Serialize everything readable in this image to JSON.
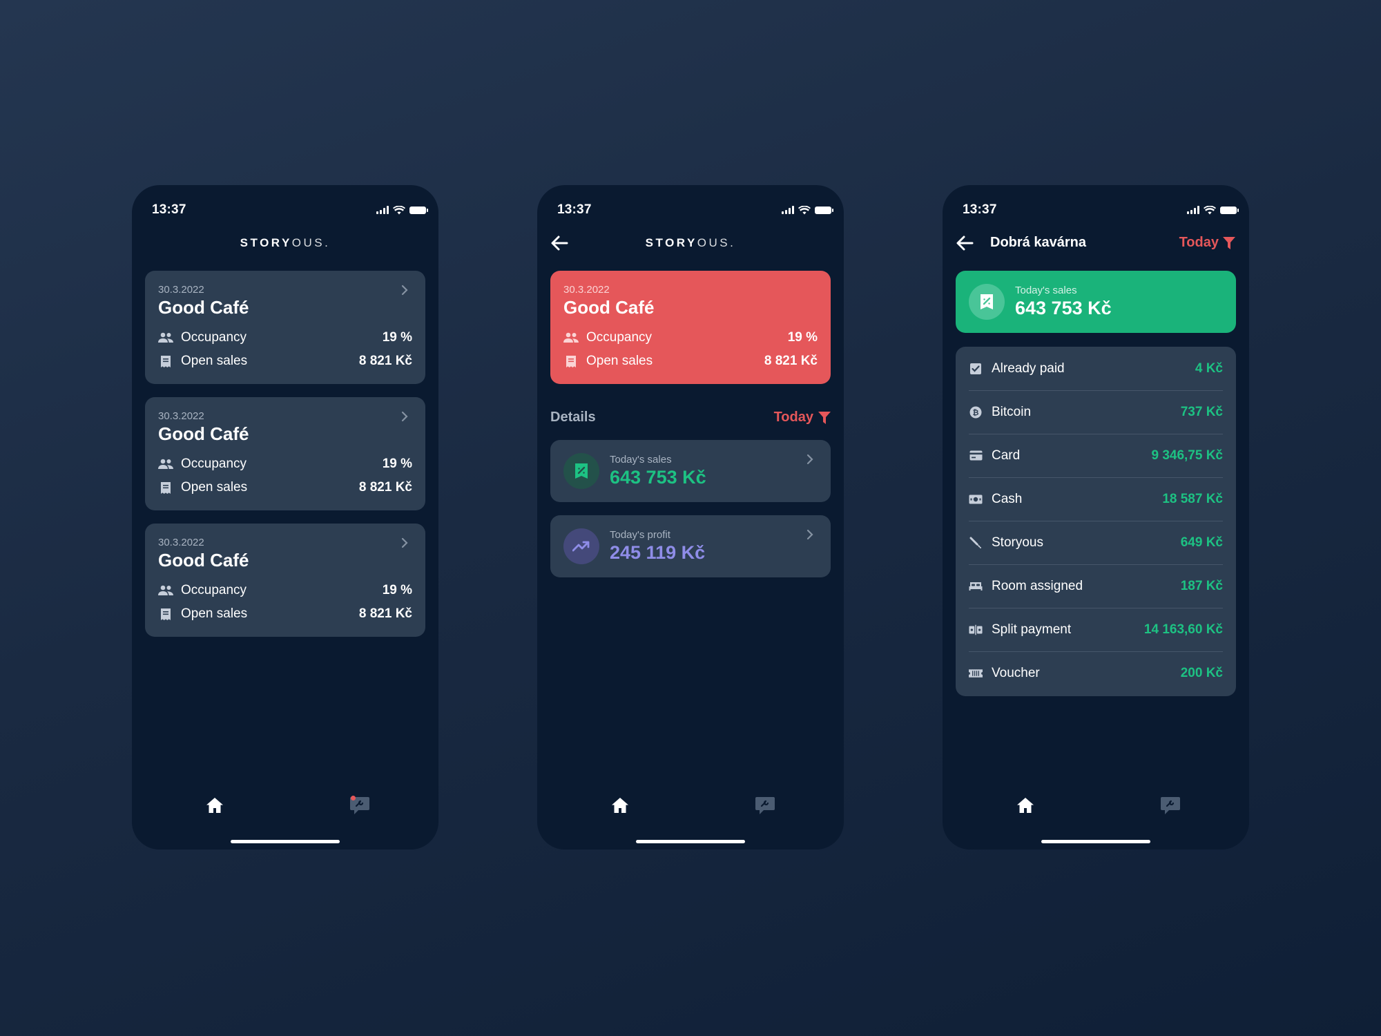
{
  "status": {
    "time": "13:37"
  },
  "brand": {
    "logo_bold": "STORY",
    "logo_light": "OUS."
  },
  "venue": {
    "date": "30.3.2022",
    "name": "Good Café",
    "occupancy_label": "Occupancy",
    "occupancy_value": "19 %",
    "open_sales_label": "Open sales",
    "open_sales_value": "8 821 Kč"
  },
  "details": {
    "title": "Details",
    "filter_label": "Today",
    "sales_label": "Today's sales",
    "sales_value": "643 753 Kč",
    "profit_label": "Today's profit",
    "profit_value": "245 119 Kč"
  },
  "payments_screen": {
    "title": "Dobrá kavárna",
    "filter_label": "Today",
    "total_label": "Today's sales",
    "total_value": "643 753 Kč",
    "items": [
      {
        "label": "Already paid",
        "value": "4 Kč",
        "icon": "check-square-icon"
      },
      {
        "label": "Bitcoin",
        "value": "737 Kč",
        "icon": "bitcoin-icon"
      },
      {
        "label": "Card",
        "value": "9 346,75 Kč",
        "icon": "credit-card-icon"
      },
      {
        "label": "Cash",
        "value": "18 587 Kč",
        "icon": "cash-icon"
      },
      {
        "label": "Storyous",
        "value": "649 Kč",
        "icon": "storyous-icon"
      },
      {
        "label": "Room assigned",
        "value": "187 Kč",
        "icon": "bed-icon"
      },
      {
        "label": "Split payment",
        "value": "14 163,60 Kč",
        "icon": "split-icon"
      },
      {
        "label": "Voucher",
        "value": "200 Kč",
        "icon": "voucher-icon"
      }
    ]
  },
  "colors": {
    "background": "#1a2a42",
    "phone": "#0a1a30",
    "card": "#2d3e52",
    "accent_red": "#e5575a",
    "accent_green": "#1dc283",
    "accent_purple": "#8f8de8"
  }
}
